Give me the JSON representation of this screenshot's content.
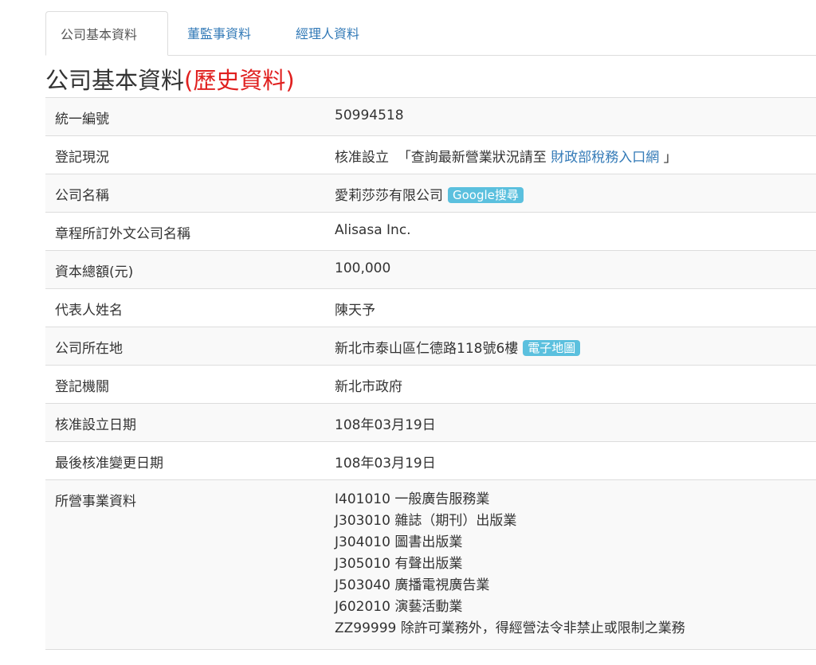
{
  "tabs": [
    {
      "label": "公司基本資料",
      "active": true
    },
    {
      "label": "董監事資料",
      "active": false
    },
    {
      "label": "經理人資料",
      "active": false
    }
  ],
  "heading": {
    "main": "公司基本資料",
    "history": "(歷史資料)"
  },
  "rows": {
    "id": {
      "label": "統一編號",
      "value": "50994518"
    },
    "status": {
      "label": "登記現況",
      "value": "核准設立",
      "pre": "「查詢最新營業狀況請至",
      "link": "財政部稅務入口網",
      "post": "」"
    },
    "name": {
      "label": "公司名稱",
      "value": "愛莉莎莎有限公司",
      "badge": "Google搜尋"
    },
    "foreign_name": {
      "label": "章程所訂外文公司名稱",
      "value": "Alisasa Inc."
    },
    "capital": {
      "label": "資本總額(元)",
      "value": "100,000"
    },
    "rep": {
      "label": "代表人姓名",
      "value": "陳天予"
    },
    "address": {
      "label": "公司所在地",
      "value": "新北市泰山區仁德路118號6樓",
      "badge": "電子地圖"
    },
    "authority": {
      "label": "登記機關",
      "value": "新北市政府"
    },
    "approve_date": {
      "label": "核准設立日期",
      "value": "108年03月19日"
    },
    "change_date": {
      "label": "最後核准變更日期",
      "value": "108年03月19日"
    },
    "business": {
      "label": "所營事業資料",
      "items": [
        "I401010 一般廣告服務業",
        "J303010 雜誌（期刊）出版業",
        "J304010 圖書出版業",
        "J305010 有聲出版業",
        "J503040 廣播電視廣告業",
        "J602010 演藝活動業",
        "ZZ99999 除許可業務外，得經營法令非禁止或限制之業務"
      ]
    }
  },
  "colors": {
    "link": "#337ab7",
    "badge": "#5bc0de",
    "history": "#e0201f",
    "stripe": "#f9f9f9"
  }
}
